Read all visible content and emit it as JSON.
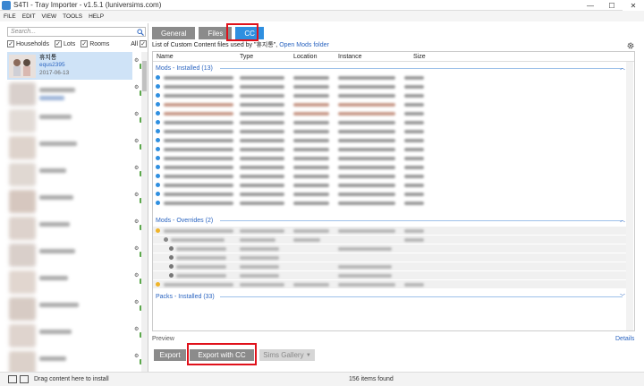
{
  "window": {
    "title": "S4TI - Tray Importer - v1.5.1 (luniversims.com)",
    "controls": [
      "—",
      "☐",
      "✕"
    ]
  },
  "menu": [
    "FILE",
    "EDIT",
    "VIEW",
    "TOOLS",
    "HELP"
  ],
  "sidebar": {
    "search_placeholder": "Search...",
    "filters": [
      {
        "label": "Households",
        "checked": true
      },
      {
        "label": "Lots",
        "checked": true
      },
      {
        "label": "Rooms",
        "checked": true
      }
    ],
    "all_label": "All",
    "selected_item": {
      "name": "휴지통",
      "creator": "equs2395",
      "date": "2017-06-13"
    }
  },
  "tabs": [
    {
      "label": "General",
      "active": false
    },
    {
      "label": "Files",
      "active": false
    },
    {
      "label": "CC",
      "active": true
    }
  ],
  "content": {
    "headline_prefix": "List of Custom Content files used by \"휴지통\",",
    "headline_link": "Open Mods folder",
    "columns": [
      "Name",
      "Type",
      "Location",
      "Instance",
      "Size"
    ],
    "sections": [
      {
        "title": "Mods - Installed",
        "count": "(13)"
      },
      {
        "title": "Mods - Overrides",
        "count": "(2)"
      },
      {
        "title": "Packs - Installed",
        "count": "(33)"
      }
    ]
  },
  "preview_label": "Preview",
  "details_link": "Details",
  "buttons": {
    "export": "Export",
    "export_cc": "Export with CC",
    "gallery": "Sims Gallery"
  },
  "status": {
    "drag_hint": "Drag content here to install",
    "count": "156 items found"
  },
  "colors": {
    "accent": "#2f8fe0",
    "highlight": "#e0111b",
    "status_green": "#5ba84b"
  }
}
